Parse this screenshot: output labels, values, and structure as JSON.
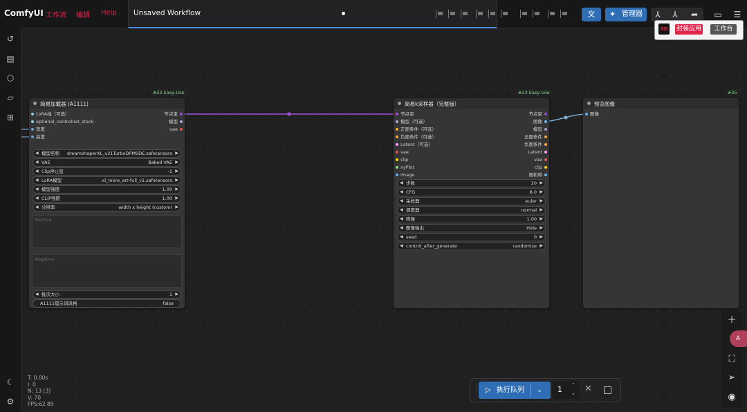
{
  "app": {
    "logo": "ComfyUI",
    "menu": [
      "工作流",
      "编辑",
      "Help"
    ],
    "workflow_tab_title": "Unsaved Workflow",
    "accent_color": "#2f6db5",
    "menu_color": "#e2264a"
  },
  "toolbar": {
    "translate_icon": "translate-icon",
    "manager_icon": "puzzle-icon",
    "manager_label": "管理器",
    "icons": [
      "linear-icon",
      "linear-alt-icon",
      "share-icon",
      "panel-toggle-icon",
      "hamburger-menu-icon"
    ]
  },
  "floating_panel": {
    "logo_text": "SD",
    "pack_app_label": "封装应用",
    "workbench_label": "工作台"
  },
  "sidebar": {
    "top_icons": [
      "history-icon",
      "queue-list-icon",
      "model-cube-icon",
      "folder-icon",
      "node-tree-icon"
    ],
    "bottom_icons": [
      "moon-icon",
      "settings-gear-icon"
    ]
  },
  "stats": {
    "t": "T: 0.00s",
    "i": "I: 0",
    "n": "N: 13 [3]",
    "v": "V: 70",
    "fps": "FPS:62.89"
  },
  "nodes": {
    "loader": {
      "badge": "#22 Easy-Use",
      "title": "简易加载器 (A1111)",
      "inputs": [
        "LoRA栈（可选）",
        "optional_controlnet_stack",
        "宽度",
        "高度"
      ],
      "outputs": [
        "节点束",
        "模型",
        "vae"
      ],
      "widgets": [
        {
          "label": "模型名称",
          "value": "dreamshaperXL_v21TurboDPMSDE.safetensors"
        },
        {
          "label": "VAE",
          "value": "Baked VAE"
        },
        {
          "label": "Clip停止层",
          "value": "-1"
        },
        {
          "label": "LoRA模型",
          "value": "xl_more_art-full_v1.safetensors"
        },
        {
          "label": "模型强度",
          "value": "1.00"
        },
        {
          "label": "CLIP强度",
          "value": "1.00"
        },
        {
          "label": "分辨率",
          "value": "width x height (custom)"
        }
      ],
      "positive_placeholder": "Positive",
      "negative_placeholder": "Negative",
      "widgets_bottom": [
        {
          "label": "批次大小",
          "value": "1"
        }
      ],
      "toggle": {
        "label": "A1111提示词风格",
        "value": "false"
      }
    },
    "sampler": {
      "badge": "#23 Easy-Use",
      "title": "简易k采样器（完整版）",
      "inputs": [
        "节点束",
        "模型（可选）",
        "正面条件（可选）",
        "负面条件（可选）",
        "Latent（可选）",
        "vae",
        "clip",
        "xyPlot",
        "image"
      ],
      "outputs": [
        "节点束",
        "图像",
        "模型",
        "正面条件",
        "负面条件",
        "Latent",
        "vae",
        "clip",
        "随机种"
      ],
      "widgets": [
        {
          "label": "步数",
          "value": "20"
        },
        {
          "label": "CFG",
          "value": "8.0"
        },
        {
          "label": "采样器",
          "value": "euler"
        },
        {
          "label": "调度器",
          "value": "normal"
        },
        {
          "label": "降噪",
          "value": "1.00"
        },
        {
          "label": "图像输出",
          "value": "Hide"
        },
        {
          "label": "seed",
          "value": "0"
        },
        {
          "label": "control_after_generate",
          "value": "randomize"
        }
      ]
    },
    "preview": {
      "badge": "#25",
      "title": "预览图像",
      "inputs": [
        "图像"
      ]
    }
  },
  "right_toolbar": {
    "icons": [
      "zoom-in-plus-icon",
      "fit-view-icon",
      "navigate-arrow-icon",
      "visibility-eye-icon"
    ],
    "bubble_text": "A"
  },
  "run_queue": {
    "run_label": "执行队列",
    "count": "1",
    "play_icon": "play-icon",
    "dropdown_icon": "chevron-down-icon",
    "cancel_icon": "close-icon",
    "stop_icon": "stop-square-icon"
  }
}
